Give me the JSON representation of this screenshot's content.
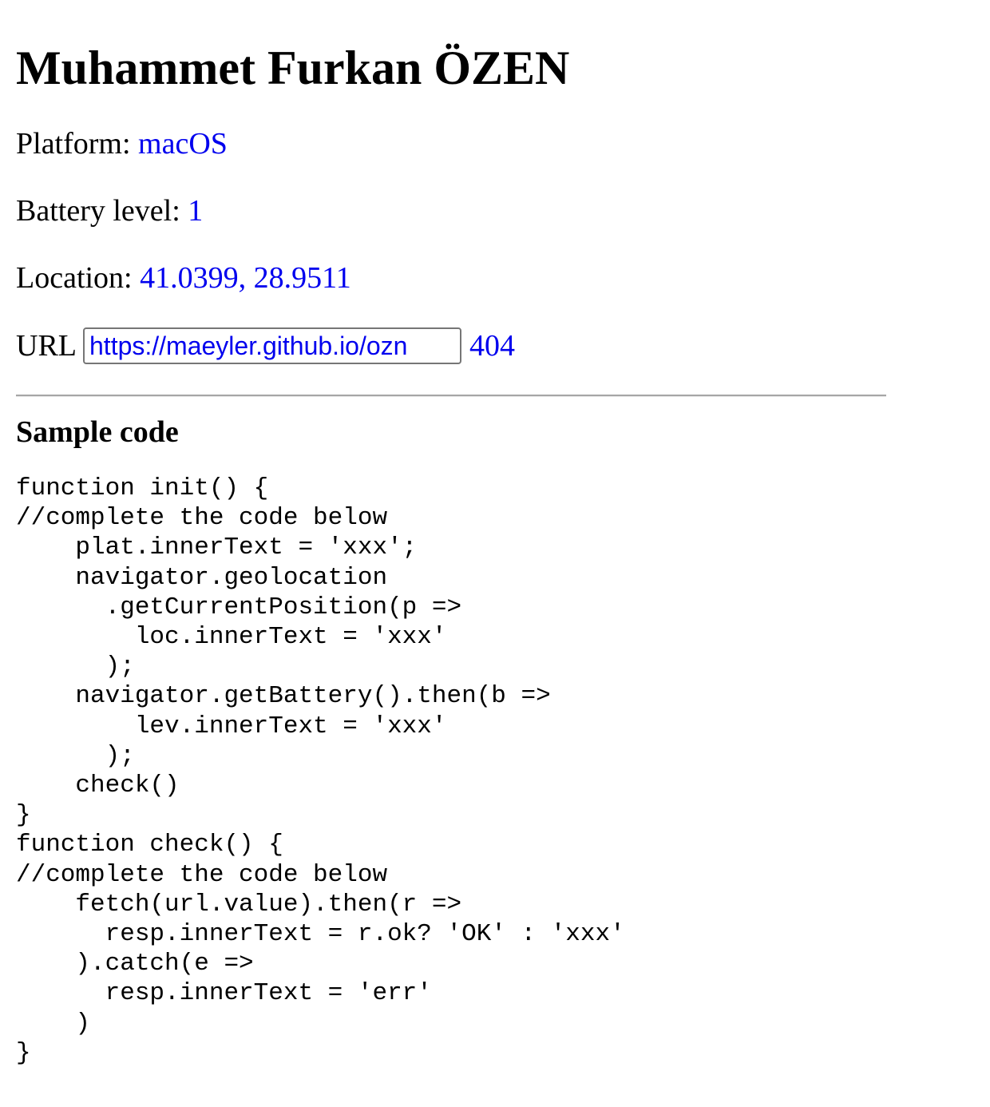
{
  "heading": "Muhammet Furkan ÖZEN",
  "platform": {
    "label": "Platform: ",
    "value": "macOS"
  },
  "battery": {
    "label": "Battery level: ",
    "value": "1"
  },
  "location": {
    "label": "Location: ",
    "value": "41.0399, 28.9511"
  },
  "url": {
    "label": "URL",
    "input_value": "https://maeyler.github.io/ozn",
    "response": "404"
  },
  "section_title": "Sample code",
  "sample_code": "function init() {\n//complete the code below\n    plat.innerText = 'xxx';\n    navigator.geolocation\n      .getCurrentPosition(p =>\n        loc.innerText = 'xxx'\n      );\n    navigator.getBattery().then(b =>\n        lev.innerText = 'xxx'\n      );\n    check()\n}\nfunction check() {\n//complete the code below\n    fetch(url.value).then(r =>\n      resp.innerText = r.ok? 'OK' : 'xxx'\n    ).catch(e =>\n      resp.innerText = 'err'\n    )\n}"
}
